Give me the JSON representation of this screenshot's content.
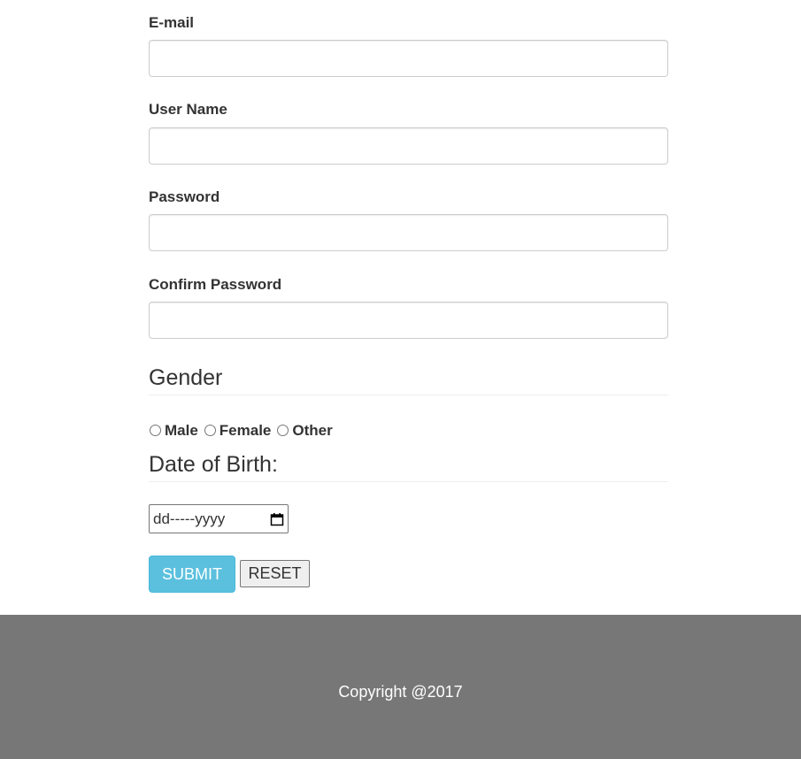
{
  "form": {
    "email": {
      "label": "E-mail",
      "value": "",
      "placeholder": ""
    },
    "username": {
      "label": "User Name",
      "value": "",
      "placeholder": ""
    },
    "password": {
      "label": "Password",
      "value": "",
      "placeholder": ""
    },
    "confirm_password": {
      "label": "Confirm Password",
      "value": "",
      "placeholder": ""
    },
    "gender": {
      "heading": "Gender",
      "options": [
        "Male",
        "Female",
        "Other"
      ],
      "selected": null
    },
    "dob": {
      "heading": "Date of Birth:",
      "display_value": "dd-----yyyy",
      "icon": "calendar-icon"
    },
    "buttons": {
      "submit_label": "SUBMIT",
      "reset_label": "RESET"
    }
  },
  "footer": {
    "copyright": "Copyright @2017"
  },
  "colors": {
    "submit_bg": "#5bc0de",
    "footer_bg": "#777777",
    "text": "#333333"
  }
}
